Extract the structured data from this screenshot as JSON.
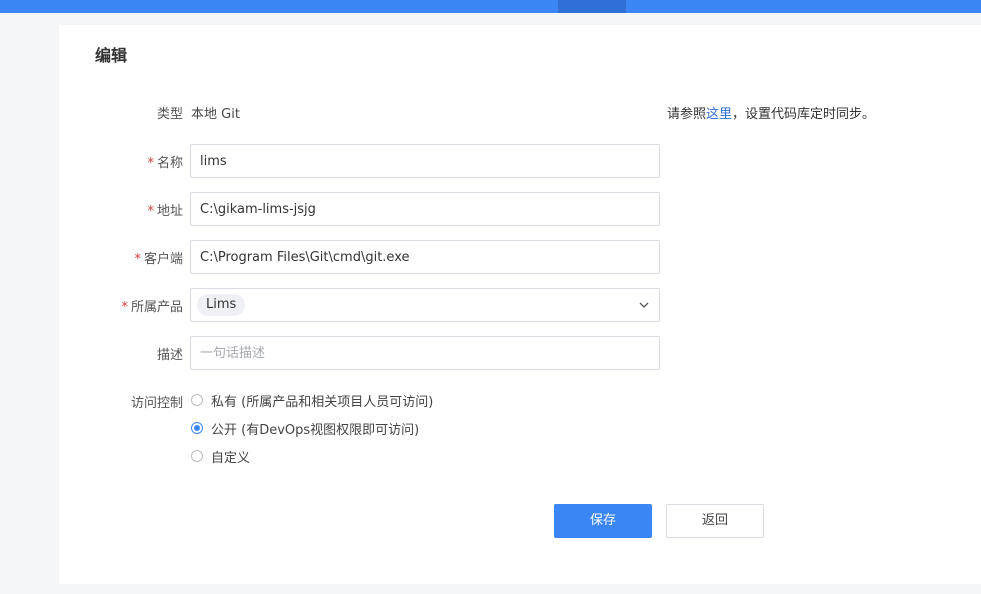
{
  "panel": {
    "title": "编辑"
  },
  "form": {
    "type": {
      "label": "类型",
      "value": "本地 Git"
    },
    "hint": {
      "prefix": "请参照",
      "link": "这里",
      "suffix": "，设置代码库定时同步。"
    },
    "name": {
      "required_mark": "*",
      "label": "名称",
      "value": "lims"
    },
    "address": {
      "required_mark": "*",
      "label": "地址",
      "value": "C:\\gikam-lims-jsjg"
    },
    "client": {
      "required_mark": "*",
      "label": "客户端",
      "value": "C:\\Program Files\\Git\\cmd\\git.exe"
    },
    "product": {
      "required_mark": "*",
      "label": "所属产品",
      "selected": "Lims"
    },
    "description": {
      "label": "描述",
      "value": "",
      "placeholder": "一句话描述"
    },
    "access": {
      "label": "访问控制",
      "options": [
        {
          "label": "私有 (所属产品和相关项目人员可访问)",
          "checked": false
        },
        {
          "label": "公开 (有DevOps视图权限即可访问)",
          "checked": true
        },
        {
          "label": "自定义",
          "checked": false
        }
      ]
    }
  },
  "actions": {
    "save_label": "保存",
    "back_label": "返回"
  },
  "colors": {
    "accent": "#3b86f5",
    "required": "#e53935",
    "link": "#2f6fd6"
  }
}
